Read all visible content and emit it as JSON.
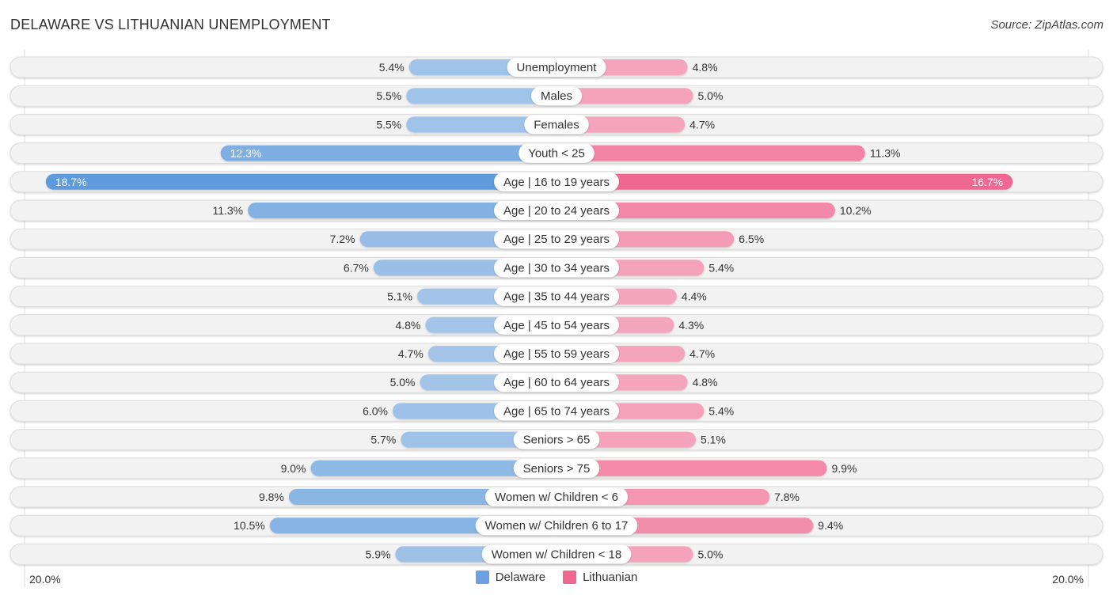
{
  "header": {
    "title": "DELAWARE VS LITHUANIAN UNEMPLOYMENT",
    "source": "Source: ZipAtlas.com"
  },
  "colors": {
    "delaware_light": "#a7c7ea",
    "delaware_dark": "#5e9bdc",
    "lithuanian_light": "#f5a8c0",
    "lithuanian_dark": "#f06892",
    "track": "#f2f2f2",
    "track_border": "#dcdcdc"
  },
  "legend": {
    "items": [
      {
        "label": "Delaware",
        "color": "#6aa1de"
      },
      {
        "label": "Lithuanian",
        "color": "#f06892"
      }
    ]
  },
  "chart_data": {
    "type": "bar",
    "orientation": "horizontal-diverging",
    "title": "DELAWARE VS LITHUANIAN UNEMPLOYMENT",
    "xlabel": "",
    "ylabel": "",
    "axis_min_label": "20.0%",
    "axis_max_label": "20.0%",
    "xlim": [
      -20,
      20
    ],
    "legend_position": "bottom-center",
    "categories": [
      "Unemployment",
      "Males",
      "Females",
      "Youth < 25",
      "Age | 16 to 19 years",
      "Age | 20 to 24 years",
      "Age | 25 to 29 years",
      "Age | 30 to 34 years",
      "Age | 35 to 44 years",
      "Age | 45 to 54 years",
      "Age | 55 to 59 years",
      "Age | 60 to 64 years",
      "Age | 65 to 74 years",
      "Seniors > 65",
      "Seniors > 75",
      "Women w/ Children < 6",
      "Women w/ Children 6 to 17",
      "Women w/ Children < 18"
    ],
    "series": [
      {
        "name": "Delaware",
        "side": "left",
        "values": [
          5.4,
          5.5,
          5.5,
          12.3,
          18.7,
          11.3,
          7.2,
          6.7,
          5.1,
          4.8,
          4.7,
          5.0,
          6.0,
          5.7,
          9.0,
          9.8,
          10.5,
          5.9
        ],
        "labels": [
          "5.4%",
          "5.5%",
          "5.5%",
          "12.3%",
          "18.7%",
          "11.3%",
          "7.2%",
          "6.7%",
          "5.1%",
          "4.8%",
          "4.7%",
          "5.0%",
          "6.0%",
          "5.7%",
          "9.0%",
          "9.8%",
          "10.5%",
          "5.9%"
        ]
      },
      {
        "name": "Lithuanian",
        "side": "right",
        "values": [
          4.8,
          5.0,
          4.7,
          11.3,
          16.7,
          10.2,
          6.5,
          5.4,
          4.4,
          4.3,
          4.7,
          4.8,
          5.4,
          5.1,
          9.9,
          7.8,
          9.4,
          5.0
        ],
        "labels": [
          "4.8%",
          "5.0%",
          "4.7%",
          "11.3%",
          "16.7%",
          "10.2%",
          "6.5%",
          "5.4%",
          "4.4%",
          "4.3%",
          "4.7%",
          "4.8%",
          "5.4%",
          "5.1%",
          "9.9%",
          "7.8%",
          "9.4%",
          "5.0%"
        ]
      }
    ]
  }
}
